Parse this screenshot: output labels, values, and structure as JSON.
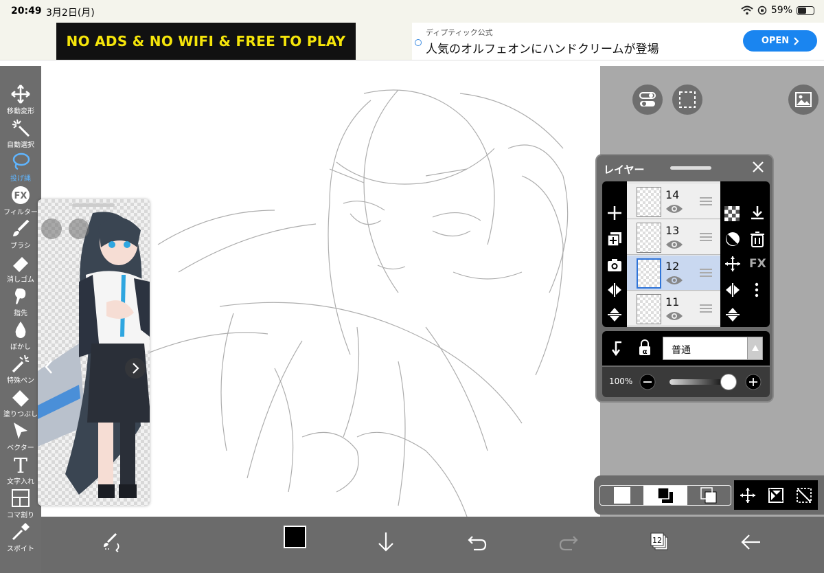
{
  "status_bar": {
    "time": "20:49",
    "date": "3月2日(月)",
    "battery_text": "59%",
    "battery_level": 0.59
  },
  "ad": {
    "banner_text": "NO ADS & NO WIFI & FREE TO PLAY",
    "sponsor": "ディプティック公式",
    "headline": "人気のオルフェオンにハンドクリームが登場",
    "open_label": "OPEN"
  },
  "tools": [
    {
      "label": "移動変形",
      "icon": "move-transform-icon"
    },
    {
      "label": "自動選択",
      "icon": "magic-wand-icon"
    },
    {
      "label": "投げ縄",
      "icon": "lasso-icon",
      "active": true
    },
    {
      "label": "フィルター",
      "icon": "fx-filter-icon"
    },
    {
      "label": "ブラシ",
      "icon": "brush-icon"
    },
    {
      "label": "消しゴム",
      "icon": "eraser-icon"
    },
    {
      "label": "指先",
      "icon": "smudge-icon"
    },
    {
      "label": "ぼかし",
      "icon": "blur-icon"
    },
    {
      "label": "特殊ペン",
      "icon": "special-pen-icon"
    },
    {
      "label": "塗りつぶし",
      "icon": "fill-bucket-icon"
    },
    {
      "label": "ベクター",
      "icon": "vector-icon"
    },
    {
      "label": "文字入れ",
      "icon": "text-icon"
    },
    {
      "label": "コマ割り",
      "icon": "frame-divide-icon"
    },
    {
      "label": "スポイト",
      "icon": "eyedropper-icon"
    }
  ],
  "layer_panel": {
    "title": "レイヤー",
    "layers": [
      {
        "number": "14",
        "selected": false
      },
      {
        "number": "13",
        "selected": false
      },
      {
        "number": "12",
        "selected": true
      },
      {
        "number": "11",
        "selected": false
      }
    ],
    "blend_mode": "普通",
    "opacity_label": "100%",
    "opacity": 1.0,
    "fx_label": "FX"
  },
  "bottom_bar": {
    "layer_count_badge": "12",
    "current_color": "#000000"
  },
  "colors": {
    "accent": "#1a85f0",
    "active_tool": "#5fb5ff",
    "toolbar_bg": "#6d6d6d"
  }
}
